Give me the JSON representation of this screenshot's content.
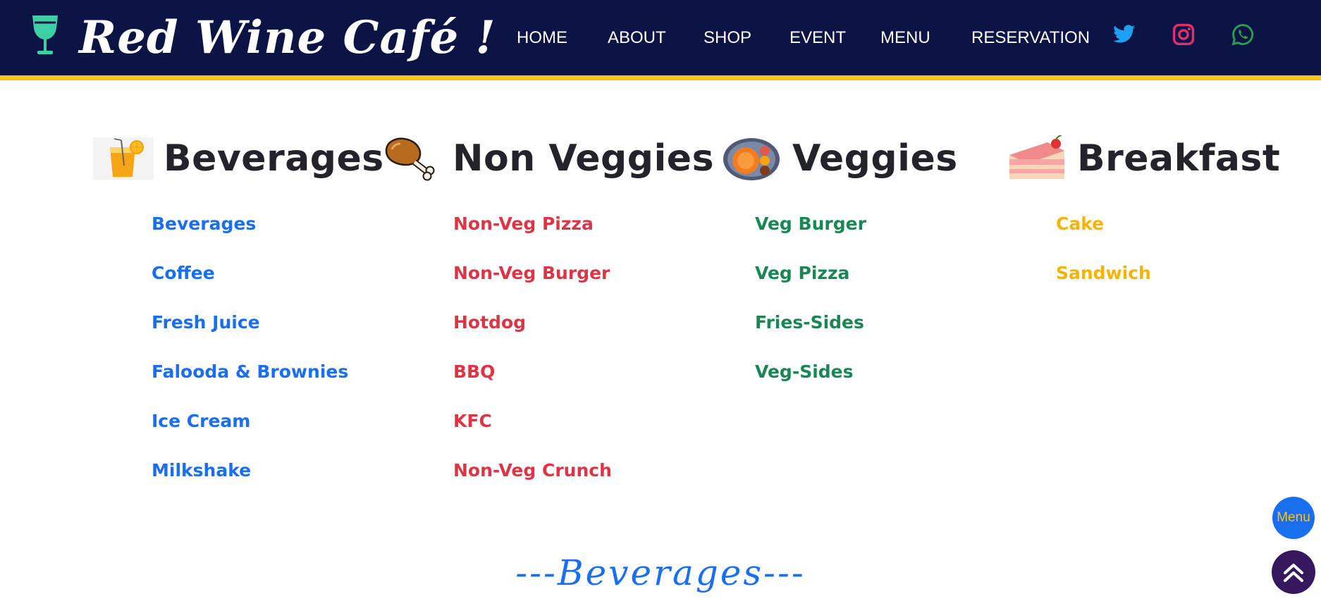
{
  "brand": {
    "name": "Red Wine Café !",
    "accent_color": "#3ecfa4"
  },
  "nav": {
    "items": [
      "HOME",
      "ABOUT",
      "SHOP",
      "EVENT",
      "MENU",
      "RESERVATION"
    ],
    "social": [
      "twitter-icon",
      "instagram-icon",
      "whatsapp-icon"
    ]
  },
  "categories": [
    {
      "title": "Beverages",
      "icon": "juice-glass-icon",
      "color": "#1a6ff0",
      "links": [
        "Beverages",
        "Coffee",
        "Fresh Juice",
        "Falooda & Brownies",
        "Ice Cream",
        "Milkshake"
      ]
    },
    {
      "title": "Non Veggies",
      "icon": "chicken-leg-icon",
      "color": "#dc3545",
      "links": [
        "Non-Veg Pizza",
        "Non-Veg Burger",
        "Hotdog",
        "BBQ",
        "KFC",
        "Non-Veg Crunch"
      ]
    },
    {
      "title": "Veggies",
      "icon": "veg-plate-icon",
      "color": "#198754",
      "links": [
        "Veg Burger",
        "Veg Pizza",
        "Fries-Sides",
        "Veg-Sides"
      ]
    },
    {
      "title": "Breakfast",
      "icon": "cake-slice-icon",
      "color": "#f5b400",
      "links": [
        "Cake",
        "Sandwich"
      ]
    }
  ],
  "floating": {
    "menu_label": "Menu",
    "top_icon": "double-chevron-up-icon"
  },
  "section": {
    "title": "---Beverages---"
  },
  "colors": {
    "navbar": "#0c1446",
    "navbar_border": "#f5c518"
  }
}
